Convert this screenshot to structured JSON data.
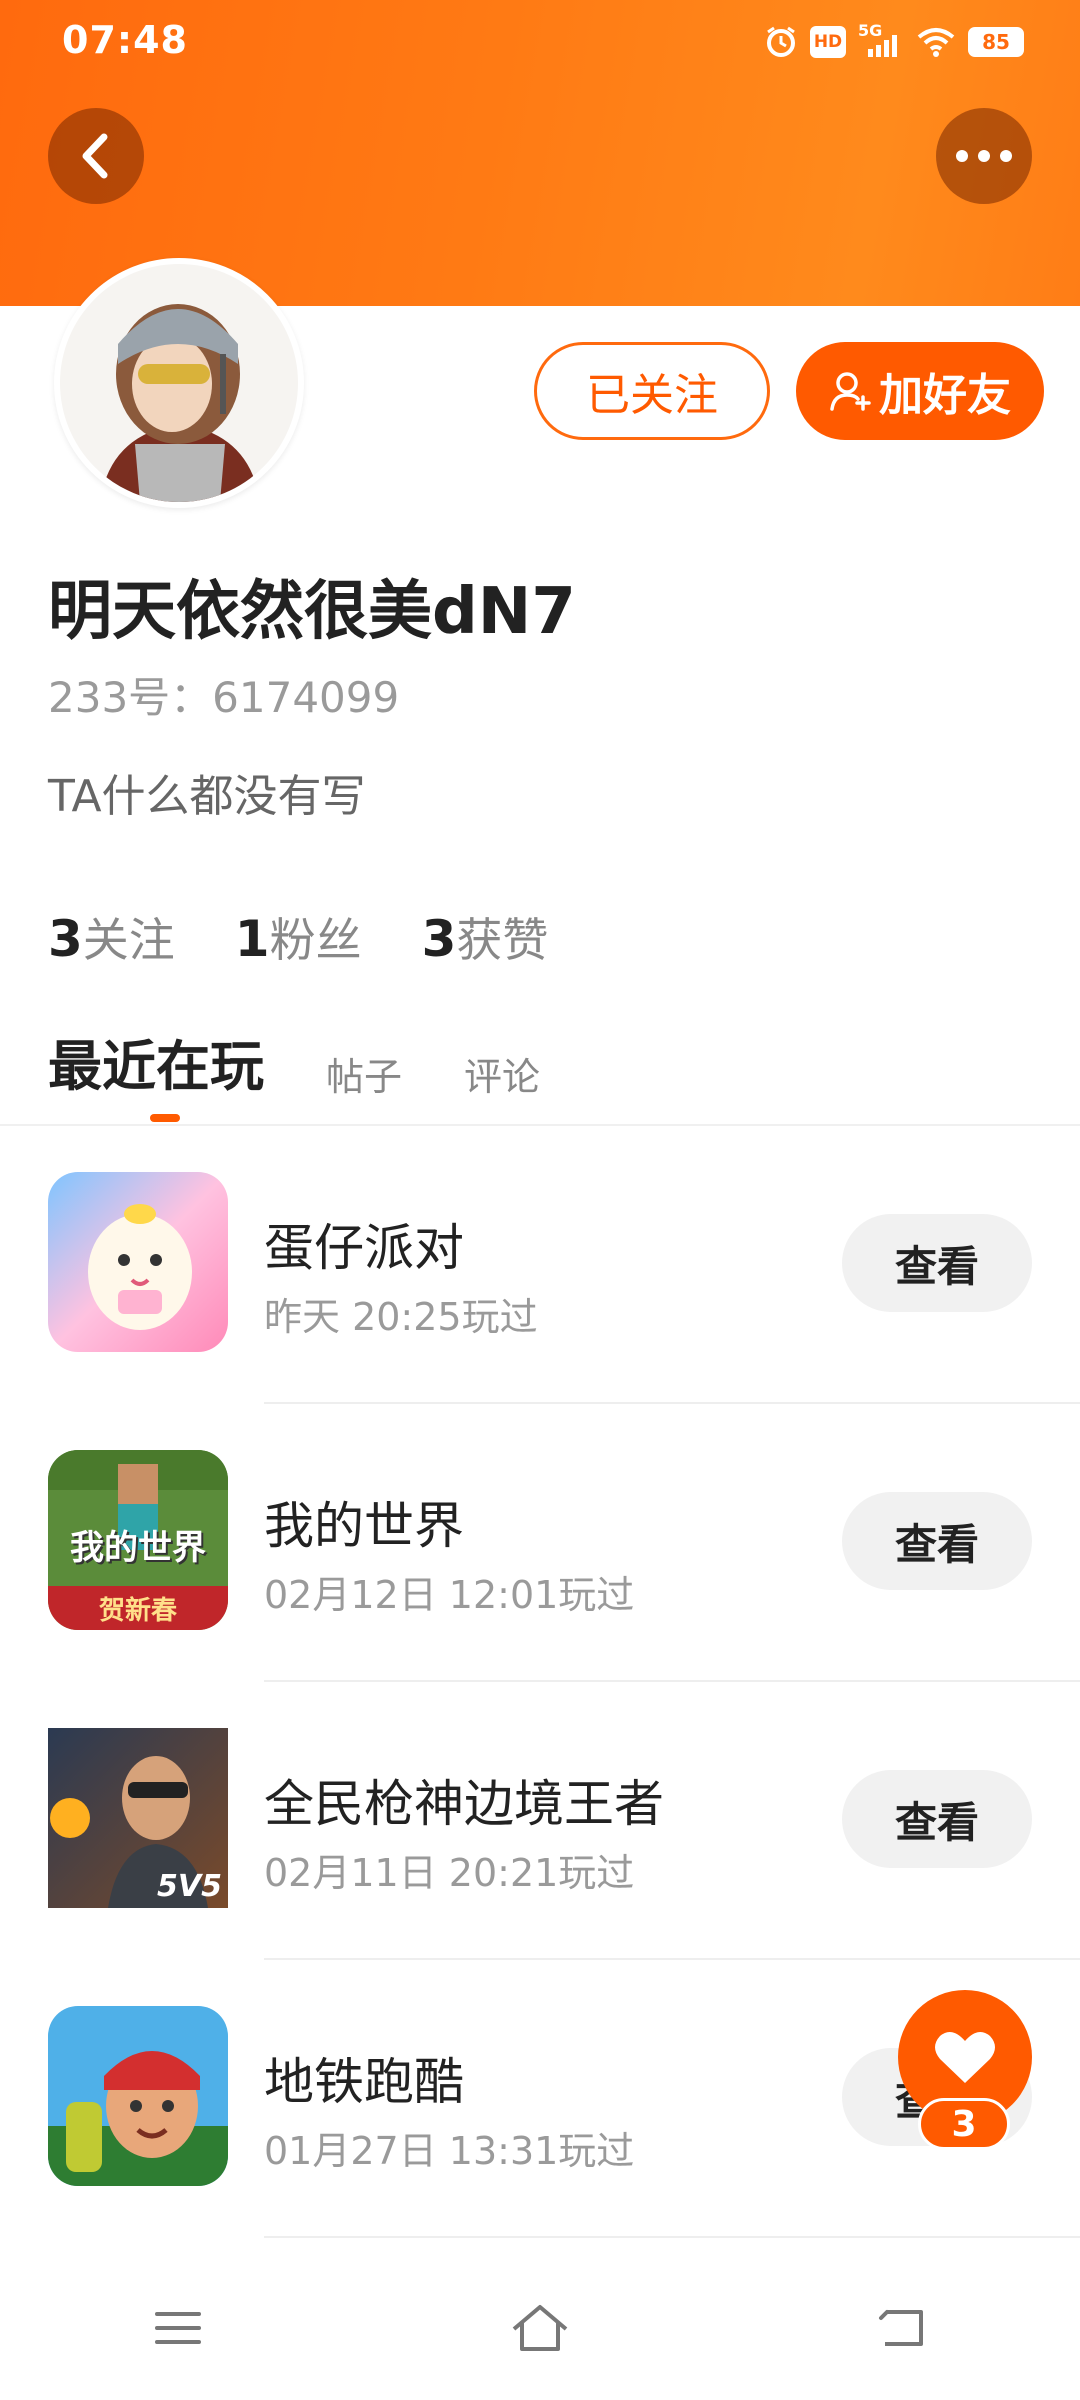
{
  "status_bar": {
    "time": "07:48",
    "icons": [
      "alarm-icon",
      "hd-icon",
      "5g-signal-icon",
      "wifi-icon",
      "battery-icon"
    ],
    "hd_label": "HD",
    "network_label": "5G",
    "battery": "85"
  },
  "header": {
    "back_icon": "chevron-left-icon",
    "more_icon": "more-dots-icon",
    "gradient_colors": [
      "#ff6a0e",
      "#ff8a1c"
    ]
  },
  "profile": {
    "username": "明天依然很美dN7",
    "user_id": "233号：6174099",
    "bio": "TA什么都没有写",
    "follow_label": "已关注",
    "add_friend_label": "加好友",
    "accent_color": "#ff5a00"
  },
  "stats": [
    {
      "count": "3",
      "label": "关注"
    },
    {
      "count": "1",
      "label": "粉丝"
    },
    {
      "count": "3",
      "label": "获赞"
    }
  ],
  "tabs": [
    "最近在玩",
    "帖子",
    "评论"
  ],
  "games": [
    {
      "name": "蛋仔派对",
      "played": "昨天 20:25玩过",
      "button": "查看",
      "icon": "eggy-party-icon"
    },
    {
      "name": "我的世界",
      "played": "02月12日 12:01玩过",
      "button": "查看",
      "icon": "minecraft-icon",
      "icon_text": "我的世界",
      "icon_subtext": "贺新春"
    },
    {
      "name": "全民枪神边境王者",
      "played": "02月11日 20:21玩过",
      "button": "查看",
      "icon": "shooter-game-icon",
      "icon_text": "5V5"
    },
    {
      "name": "地铁跑酷",
      "played": "01月27日 13:31玩过",
      "button": "查看",
      "icon": "subway-surfers-icon"
    }
  ],
  "fab": {
    "icon": "heart-icon",
    "count": "3"
  },
  "nav": [
    "menu-icon",
    "home-icon",
    "back-icon"
  ]
}
